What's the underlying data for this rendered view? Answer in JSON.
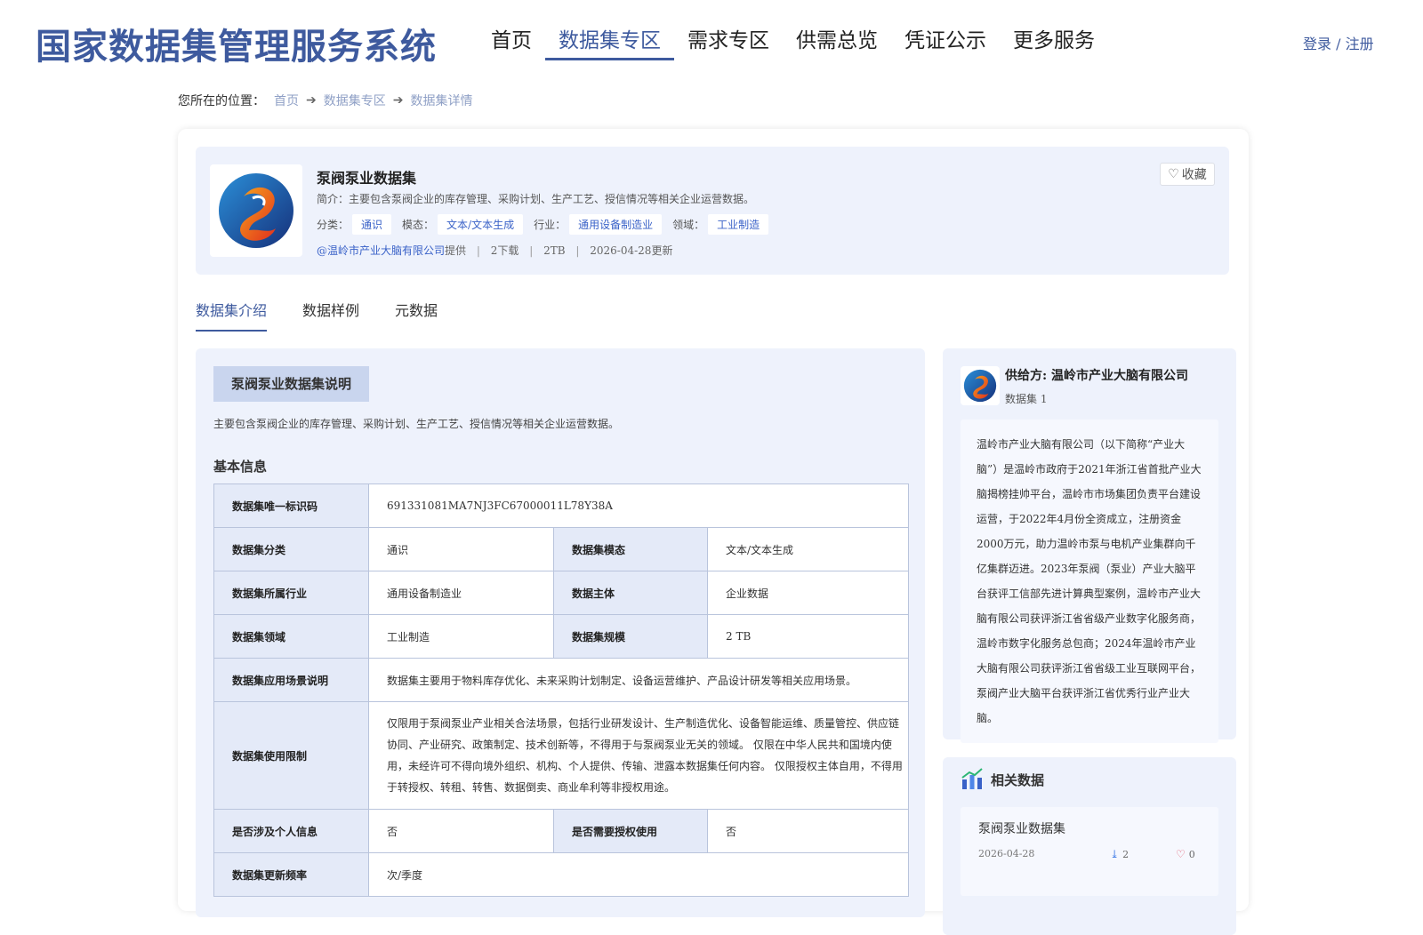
{
  "header": {
    "logo": "国家数据集管理服务系统",
    "nav": [
      {
        "label": "首页"
      },
      {
        "label": "数据集专区",
        "active": true
      },
      {
        "label": "需求专区"
      },
      {
        "label": "供需总览"
      },
      {
        "label": "凭证公示"
      },
      {
        "label": "更多服务"
      }
    ],
    "login": "登录 / 注册"
  },
  "breadcrumb": {
    "prefix": "您所在的位置：",
    "items": [
      "首页",
      "数据集专区",
      "数据集详情"
    ]
  },
  "dataset": {
    "title": "泵阀泵业数据集",
    "brief": "简介：主要包含泵阀企业的库存管理、采购计划、生产工艺、授信情况等相关企业运营数据。",
    "tags": [
      {
        "label": "分类：",
        "value": "通识"
      },
      {
        "label": "模态：",
        "value": "文本/文本生成"
      },
      {
        "label": "行业：",
        "value": "通用设备制造业"
      },
      {
        "label": "领域：",
        "value": "工业制造"
      }
    ],
    "provider": "@温岭市产业大脑有限公司",
    "provider_suffix": "提供",
    "downloads": "2下载",
    "size": "2TB",
    "updated": "2026-04-28更新",
    "favorite_label": "收藏"
  },
  "tabs": [
    "数据集介绍",
    "数据样例",
    "元数据"
  ],
  "intro": {
    "section_title": "泵阀泵业数据集说明",
    "description": "主要包含泵阀企业的库存管理、采购计划、生产工艺、授信情况等相关企业运营数据。",
    "basic_title": "基本信息",
    "rows": {
      "uid_k": "数据集唯一标识码",
      "uid_v": "691331081MA7NJ3FC67000011L78Y38A",
      "cat_k": "数据集分类",
      "cat_v": "通识",
      "mod_k": "数据集模态",
      "mod_v": "文本/文本生成",
      "ind_k": "数据集所属行业",
      "ind_v": "通用设备制造业",
      "sub_k": "数据主体",
      "sub_v": "企业数据",
      "dom_k": "数据集领域",
      "dom_v": "工业制造",
      "scale_k": "数据集规模",
      "scale_v": "2 TB",
      "scene_k": "数据集应用场景说明",
      "scene_v": "数据集主要用于物料库存优化、未来采购计划制定、设备运营维护、产品设计研发等相关应用场景。",
      "limit_k": "数据集使用限制",
      "limit_v": "仅限用于泵阀泵业产业相关合法场景，包括行业研发设计、生产制造优化、设备智能运维、质量管控、供应链协同、产业研究、政策制定、技术创新等，不得用于与泵阀泵业无关的领域。 仅限在中华人民共和国境内使用，未经许可不得向境外组织、机构、个人提供、传输、泄露本数据集任何内容。 仅限授权主体自用，不得用于转授权、转租、转售、数据倒卖、商业牟利等非授权用途。",
      "pi_k": "是否涉及个人信息",
      "pi_v": "否",
      "auth_k": "是否需要授权使用",
      "auth_v": "否",
      "freq_k": "数据集更新频率",
      "freq_v": "次/季度"
    }
  },
  "provider_card": {
    "name": "供给方: 温岭市产业大脑有限公司",
    "count": "数据集 1",
    "description": "温岭市产业大脑有限公司（以下简称“产业大脑”）是温岭市政府于2021年浙江省首批产业大脑揭榜挂帅平台，温岭市市场集团负责平台建设运营，于2022年4月份全资成立，注册资金2000万元，助力温岭市泵与电机产业集群向千亿集群迈进。2023年泵阀（泵业）产业大脑平台获评工信部先进计算典型案例，温岭市产业大脑有限公司获评浙江省省级产业数字化服务商，温岭市数字化服务总包商；2024年温岭市产业大脑有限公司获评浙江省省级工业互联网平台，泵阀产业大脑平台获评浙江省优秀行业产业大脑。"
  },
  "related": {
    "title": "相关数据",
    "items": [
      {
        "name": "泵阀泵业数据集",
        "date": "2026-04-28",
        "downloads": "2",
        "favorites": "0"
      }
    ]
  },
  "colors": {
    "brand": "#3e5a9e",
    "link": "#3a62c8",
    "panel_bg": "#eef2fc"
  }
}
